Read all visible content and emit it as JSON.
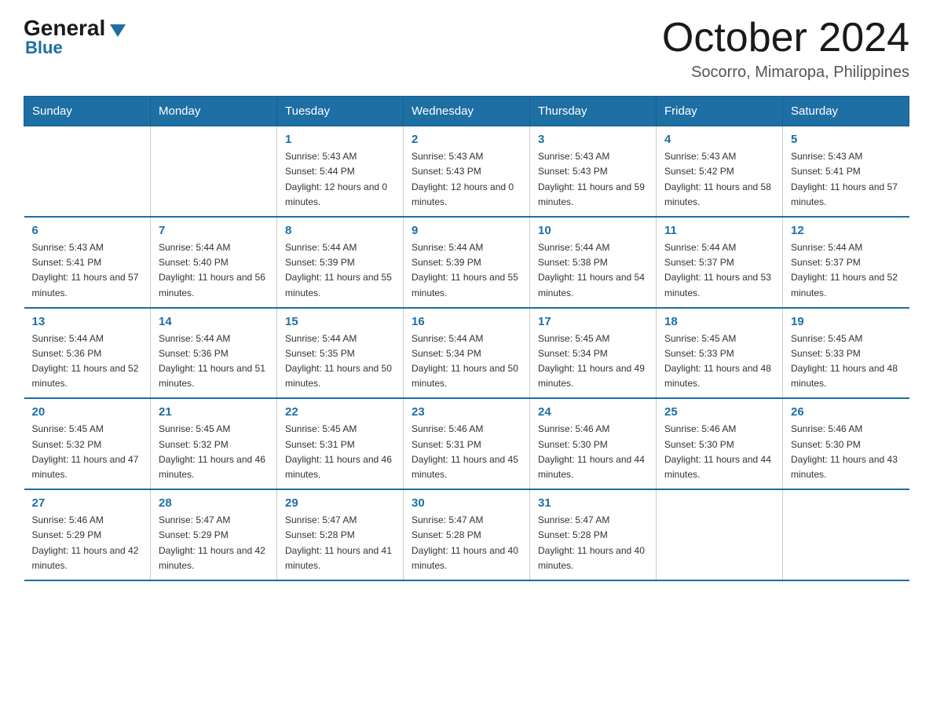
{
  "header": {
    "logo_general": "General",
    "logo_blue": "Blue",
    "month_title": "October 2024",
    "location": "Socorro, Mimaropa, Philippines"
  },
  "days_of_week": [
    "Sunday",
    "Monday",
    "Tuesday",
    "Wednesday",
    "Thursday",
    "Friday",
    "Saturday"
  ],
  "weeks": [
    [
      {
        "day": "",
        "sunrise": "",
        "sunset": "",
        "daylight": ""
      },
      {
        "day": "",
        "sunrise": "",
        "sunset": "",
        "daylight": ""
      },
      {
        "day": "1",
        "sunrise": "Sunrise: 5:43 AM",
        "sunset": "Sunset: 5:44 PM",
        "daylight": "Daylight: 12 hours and 0 minutes."
      },
      {
        "day": "2",
        "sunrise": "Sunrise: 5:43 AM",
        "sunset": "Sunset: 5:43 PM",
        "daylight": "Daylight: 12 hours and 0 minutes."
      },
      {
        "day": "3",
        "sunrise": "Sunrise: 5:43 AM",
        "sunset": "Sunset: 5:43 PM",
        "daylight": "Daylight: 11 hours and 59 minutes."
      },
      {
        "day": "4",
        "sunrise": "Sunrise: 5:43 AM",
        "sunset": "Sunset: 5:42 PM",
        "daylight": "Daylight: 11 hours and 58 minutes."
      },
      {
        "day": "5",
        "sunrise": "Sunrise: 5:43 AM",
        "sunset": "Sunset: 5:41 PM",
        "daylight": "Daylight: 11 hours and 57 minutes."
      }
    ],
    [
      {
        "day": "6",
        "sunrise": "Sunrise: 5:43 AM",
        "sunset": "Sunset: 5:41 PM",
        "daylight": "Daylight: 11 hours and 57 minutes."
      },
      {
        "day": "7",
        "sunrise": "Sunrise: 5:44 AM",
        "sunset": "Sunset: 5:40 PM",
        "daylight": "Daylight: 11 hours and 56 minutes."
      },
      {
        "day": "8",
        "sunrise": "Sunrise: 5:44 AM",
        "sunset": "Sunset: 5:39 PM",
        "daylight": "Daylight: 11 hours and 55 minutes."
      },
      {
        "day": "9",
        "sunrise": "Sunrise: 5:44 AM",
        "sunset": "Sunset: 5:39 PM",
        "daylight": "Daylight: 11 hours and 55 minutes."
      },
      {
        "day": "10",
        "sunrise": "Sunrise: 5:44 AM",
        "sunset": "Sunset: 5:38 PM",
        "daylight": "Daylight: 11 hours and 54 minutes."
      },
      {
        "day": "11",
        "sunrise": "Sunrise: 5:44 AM",
        "sunset": "Sunset: 5:37 PM",
        "daylight": "Daylight: 11 hours and 53 minutes."
      },
      {
        "day": "12",
        "sunrise": "Sunrise: 5:44 AM",
        "sunset": "Sunset: 5:37 PM",
        "daylight": "Daylight: 11 hours and 52 minutes."
      }
    ],
    [
      {
        "day": "13",
        "sunrise": "Sunrise: 5:44 AM",
        "sunset": "Sunset: 5:36 PM",
        "daylight": "Daylight: 11 hours and 52 minutes."
      },
      {
        "day": "14",
        "sunrise": "Sunrise: 5:44 AM",
        "sunset": "Sunset: 5:36 PM",
        "daylight": "Daylight: 11 hours and 51 minutes."
      },
      {
        "day": "15",
        "sunrise": "Sunrise: 5:44 AM",
        "sunset": "Sunset: 5:35 PM",
        "daylight": "Daylight: 11 hours and 50 minutes."
      },
      {
        "day": "16",
        "sunrise": "Sunrise: 5:44 AM",
        "sunset": "Sunset: 5:34 PM",
        "daylight": "Daylight: 11 hours and 50 minutes."
      },
      {
        "day": "17",
        "sunrise": "Sunrise: 5:45 AM",
        "sunset": "Sunset: 5:34 PM",
        "daylight": "Daylight: 11 hours and 49 minutes."
      },
      {
        "day": "18",
        "sunrise": "Sunrise: 5:45 AM",
        "sunset": "Sunset: 5:33 PM",
        "daylight": "Daylight: 11 hours and 48 minutes."
      },
      {
        "day": "19",
        "sunrise": "Sunrise: 5:45 AM",
        "sunset": "Sunset: 5:33 PM",
        "daylight": "Daylight: 11 hours and 48 minutes."
      }
    ],
    [
      {
        "day": "20",
        "sunrise": "Sunrise: 5:45 AM",
        "sunset": "Sunset: 5:32 PM",
        "daylight": "Daylight: 11 hours and 47 minutes."
      },
      {
        "day": "21",
        "sunrise": "Sunrise: 5:45 AM",
        "sunset": "Sunset: 5:32 PM",
        "daylight": "Daylight: 11 hours and 46 minutes."
      },
      {
        "day": "22",
        "sunrise": "Sunrise: 5:45 AM",
        "sunset": "Sunset: 5:31 PM",
        "daylight": "Daylight: 11 hours and 46 minutes."
      },
      {
        "day": "23",
        "sunrise": "Sunrise: 5:46 AM",
        "sunset": "Sunset: 5:31 PM",
        "daylight": "Daylight: 11 hours and 45 minutes."
      },
      {
        "day": "24",
        "sunrise": "Sunrise: 5:46 AM",
        "sunset": "Sunset: 5:30 PM",
        "daylight": "Daylight: 11 hours and 44 minutes."
      },
      {
        "day": "25",
        "sunrise": "Sunrise: 5:46 AM",
        "sunset": "Sunset: 5:30 PM",
        "daylight": "Daylight: 11 hours and 44 minutes."
      },
      {
        "day": "26",
        "sunrise": "Sunrise: 5:46 AM",
        "sunset": "Sunset: 5:30 PM",
        "daylight": "Daylight: 11 hours and 43 minutes."
      }
    ],
    [
      {
        "day": "27",
        "sunrise": "Sunrise: 5:46 AM",
        "sunset": "Sunset: 5:29 PM",
        "daylight": "Daylight: 11 hours and 42 minutes."
      },
      {
        "day": "28",
        "sunrise": "Sunrise: 5:47 AM",
        "sunset": "Sunset: 5:29 PM",
        "daylight": "Daylight: 11 hours and 42 minutes."
      },
      {
        "day": "29",
        "sunrise": "Sunrise: 5:47 AM",
        "sunset": "Sunset: 5:28 PM",
        "daylight": "Daylight: 11 hours and 41 minutes."
      },
      {
        "day": "30",
        "sunrise": "Sunrise: 5:47 AM",
        "sunset": "Sunset: 5:28 PM",
        "daylight": "Daylight: 11 hours and 40 minutes."
      },
      {
        "day": "31",
        "sunrise": "Sunrise: 5:47 AM",
        "sunset": "Sunset: 5:28 PM",
        "daylight": "Daylight: 11 hours and 40 minutes."
      },
      {
        "day": "",
        "sunrise": "",
        "sunset": "",
        "daylight": ""
      },
      {
        "day": "",
        "sunrise": "",
        "sunset": "",
        "daylight": ""
      }
    ]
  ]
}
